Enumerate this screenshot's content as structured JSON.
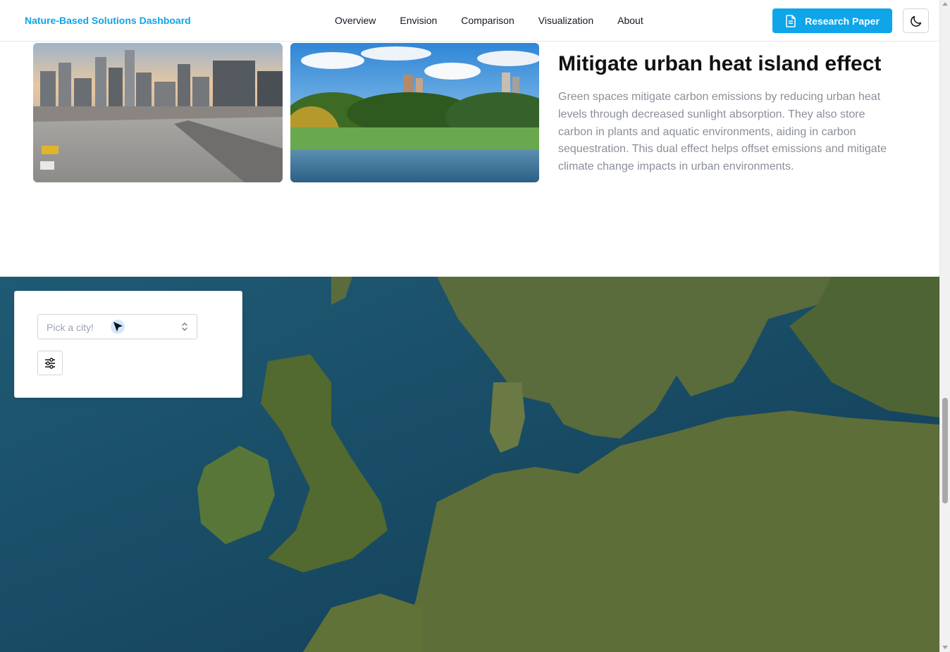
{
  "header": {
    "brand": "Nature-Based Solutions Dashboard",
    "nav": [
      "Overview",
      "Envision",
      "Comparison",
      "Visualization",
      "About"
    ],
    "research_button": "Research Paper",
    "theme_icon": "moon-icon",
    "research_icon": "document-icon"
  },
  "section": {
    "title": "Mitigate urban heat island effect",
    "text": "Green spaces mitigate carbon emissions by reducing urban heat levels through decreased sunlight absorption. They also store carbon in plants and aquatic environments, aiding in carbon sequestration. This dual effect helps offset emissions and mitigate climate change impacts in urban environments."
  },
  "map_panel": {
    "city_select_placeholder": "Pick a city!",
    "filter_icon": "sliders-icon"
  },
  "colors": {
    "accent": "#0ea5e9",
    "body_text": "#8a8f98"
  }
}
